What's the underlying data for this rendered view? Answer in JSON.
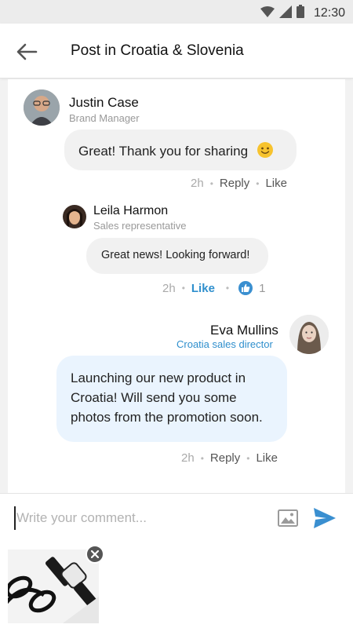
{
  "status_bar": {
    "time": "12:30"
  },
  "header": {
    "title": "Post in Croatia & Slovenia"
  },
  "comments": [
    {
      "name": "Justin Case",
      "role": "Brand Manager",
      "message": "Great! Thank you for sharing",
      "emoji": "🙂",
      "time": "2h",
      "reply_label": "Reply",
      "like_label": "Like"
    },
    {
      "name": "Leila Harmon",
      "role": "Sales representative",
      "message": "Great news! Looking forward!",
      "time": "2h",
      "like_label": "Like",
      "like_count": "1"
    },
    {
      "name": "Eva Mullins",
      "role": "Croatia sales director",
      "message": "Launching our new product in Croatia! Will send you some photos from the promotion soon.",
      "time": "2h",
      "reply_label": "Reply",
      "like_label": "Like"
    }
  ],
  "composer": {
    "placeholder": "Write your comment..."
  },
  "colors": {
    "accent": "#2f8fcd",
    "bubble_other": "#f1f1f1",
    "bubble_self": "#eaf4fe",
    "send": "#3a8fd0"
  }
}
